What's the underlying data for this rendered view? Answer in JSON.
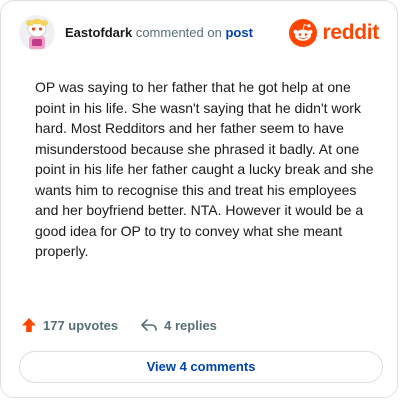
{
  "header": {
    "username": "Eastofdark",
    "action": "commented on",
    "post_link": "post",
    "avatar_icon": "snoo-avatar-icon"
  },
  "brand": {
    "icon": "reddit-snoo-icon",
    "wordmark": "reddit",
    "color": "#ff4500"
  },
  "comment": {
    "body": "OP was saying to her father that he got help at one point in his life. She wasn't saying that he didn't work hard. Most Redditors and her father seem to have misunderstood because she phrased it badly. At one point in his life her father caught a lucky break and she wants him to recognise this and treat his employees and her boyfriend better. NTA. However it would be a good idea for OP to try to convey what she meant properly."
  },
  "stats": {
    "upvotes": "177 upvotes",
    "upvote_icon": "upvote-arrow-icon",
    "replies": "4 replies",
    "reply_icon": "reply-arrow-icon"
  },
  "actions": {
    "view_comments": "View 4 comments"
  },
  "colors": {
    "accent": "#ff4500",
    "link": "#0045ac",
    "muted": "#576f76",
    "border": "#dcdfe3"
  }
}
